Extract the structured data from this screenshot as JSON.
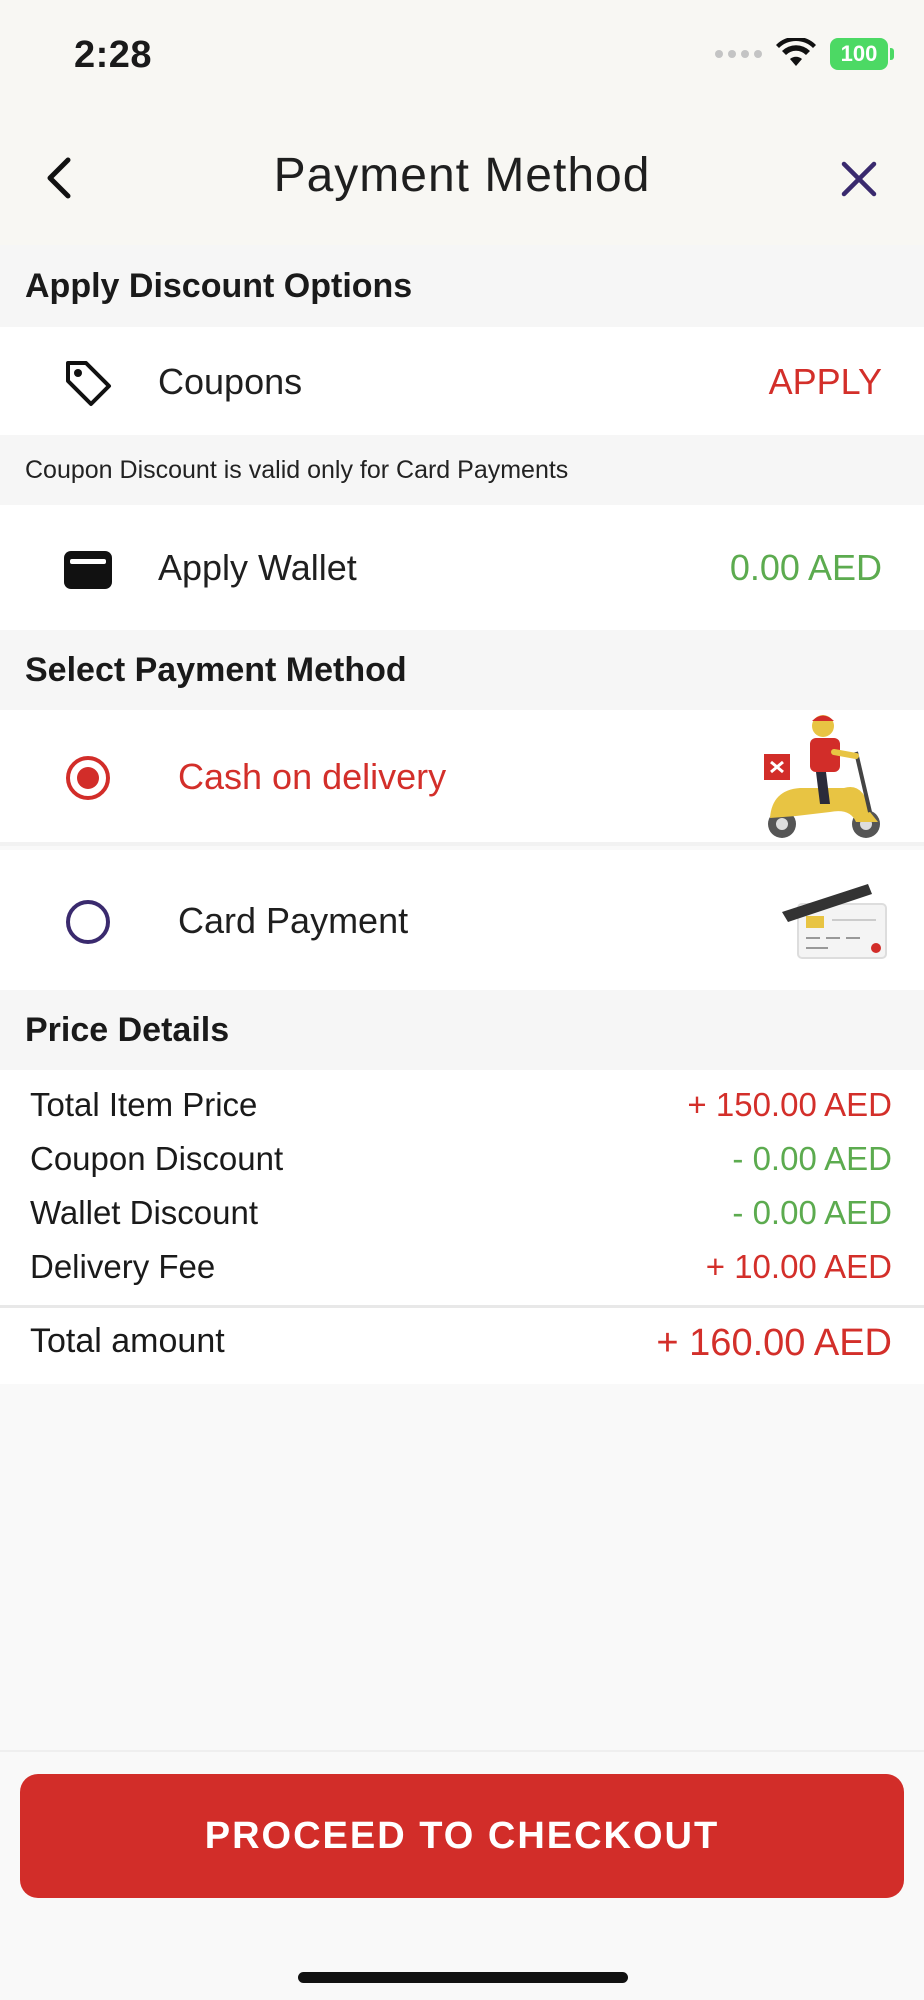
{
  "status_bar": {
    "time": "2:28",
    "battery": "100"
  },
  "nav": {
    "title": "Payment Method"
  },
  "discount_section": {
    "header": "Apply Discount Options",
    "coupons_label": "Coupons",
    "coupons_action": "APPLY",
    "note": "Coupon Discount is valid only for Card Payments",
    "wallet_label": "Apply Wallet",
    "wallet_value": "0.00 AED"
  },
  "payment_section": {
    "header": "Select Payment Method",
    "options": [
      {
        "label": "Cash on delivery",
        "selected": true
      },
      {
        "label": "Card Payment",
        "selected": false
      }
    ]
  },
  "price_section": {
    "header": "Price Details",
    "lines": [
      {
        "label": "Total Item Price",
        "value": "+ 150.00 AED"
      },
      {
        "label": "Coupon Discount",
        "value": "- 0.00 AED"
      },
      {
        "label": "Wallet Discount",
        "value": "- 0.00 AED"
      },
      {
        "label": "Delivery Fee",
        "value": "+ 10.00 AED"
      }
    ],
    "total_label": "Total amount",
    "total_value": "+ 160.00 AED"
  },
  "checkout": {
    "button_label": "PROCEED TO CHECKOUT"
  },
  "colors": {
    "accent_red": "#d22d29",
    "green": "#5cab4f",
    "navy": "#3a2a6e"
  },
  "icons": [
    "back-icon",
    "close-icon",
    "tag-icon",
    "wallet-icon",
    "delivery-scooter-icon",
    "card-icon",
    "wifi-icon",
    "battery-icon"
  ]
}
